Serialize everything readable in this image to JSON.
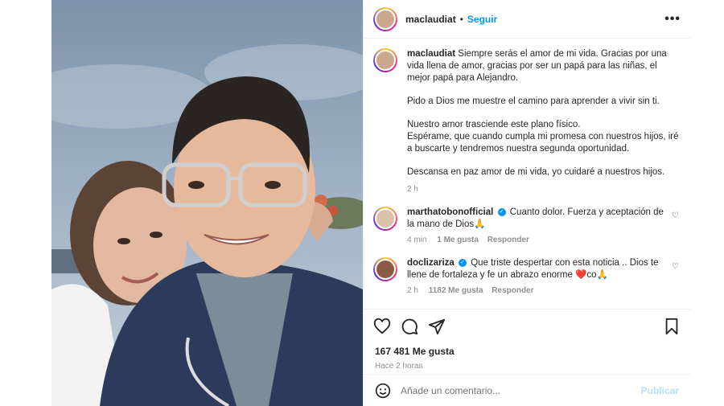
{
  "post": {
    "username": "maclaudiat",
    "follow_label": "Seguir",
    "separator": "•",
    "more_label": "•••"
  },
  "caption": {
    "username": "maclaudiat",
    "p1": "Siempre serás el amor de mi vida. Gracias por una vida llena de amor, gracias por ser un papá para las niñas, el mejor papá para Alejandro.",
    "p2": "Pido a Dios me muestre el camino para aprender a vivir sin ti.",
    "p3a": "Nuestro amor trasciende este plano físico.",
    "p3b": "Espérame, que cuando cumpla mi promesa con nuestros hijos, iré a buscarte y tendremos nuestra segunda oportunidad.",
    "p4": "Descansa en paz amor de mi vida, yo cuidaré a nuestros hijos.",
    "time": "2 h"
  },
  "comments": [
    {
      "username": "marthatobonofficial",
      "text": "Cuanto dolor. Fuerza y aceptación de la mano de Dios🙏",
      "time": "4 min",
      "likes": "1 Me gusta",
      "reply": "Responder"
    },
    {
      "username": "doclizariza",
      "text": "Que triste despertar con esta noticia .. Dios te llene de fortaleza y fe un abrazo enorme ❤️co🙏",
      "time": "2 h",
      "likes": "1182 Me gusta",
      "reply": "Responder"
    }
  ],
  "stats": {
    "likes": "167 481 Me gusta",
    "ago": "Hace 2 horas"
  },
  "add_comment": {
    "placeholder": "Añade un comentario...",
    "publish_label": "Publicar"
  },
  "colors": {
    "accent": "#0095f6",
    "publish_disabled": "#b2dffc",
    "muted": "#8e8e8e"
  }
}
